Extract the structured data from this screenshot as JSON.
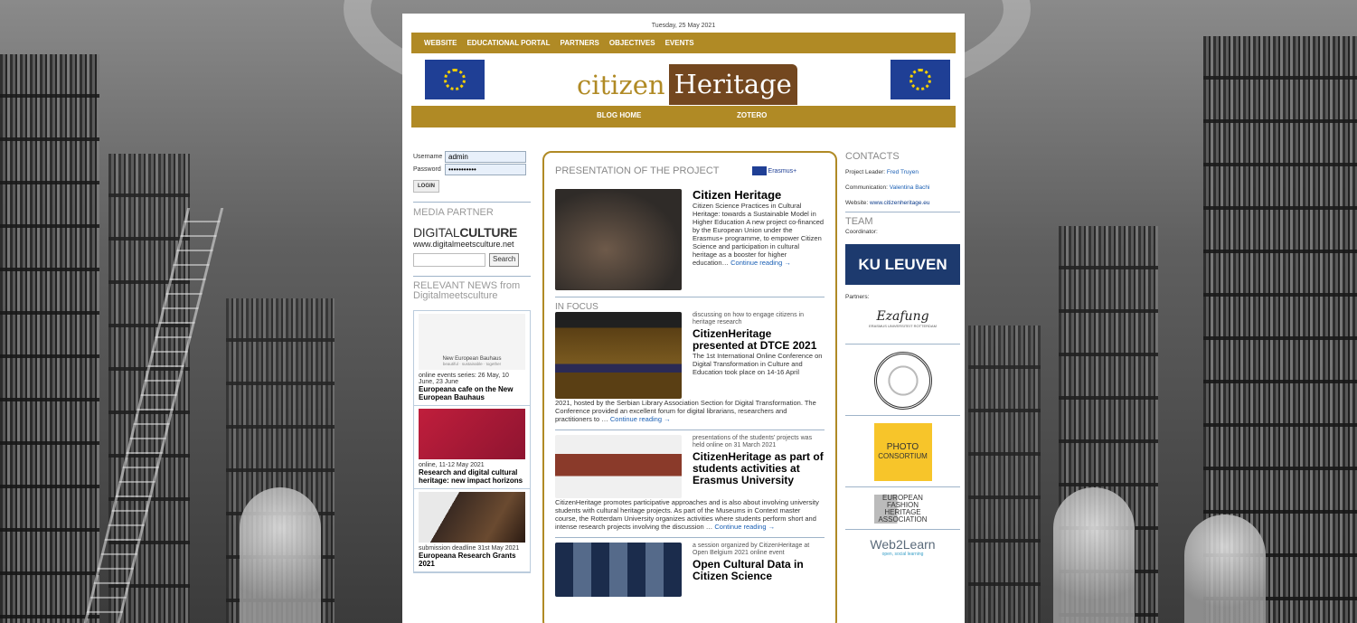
{
  "date": "Tuesday, 25 May 2021",
  "topnav": [
    "WEBSITE",
    "EDUCATIONAL PORTAL",
    "PARTNERS",
    "OBJECTIVES",
    "EVENTS"
  ],
  "logo": {
    "part1": "citizen",
    "part2": "Heritage"
  },
  "subnav": {
    "blog": "BLOG HOME",
    "zotero": "ZOTERO"
  },
  "login": {
    "username_label": "Username",
    "username_value": "admin",
    "password_label": "Password",
    "password_value": "•••••••••••",
    "button": "LOGIN"
  },
  "media_partner": {
    "title": "MEDIA PARTNER",
    "logo_a": "DIGITAL",
    "logo_b": "CULTURE",
    "url": "www.digitalmeetsculture.net",
    "search_button": "Search"
  },
  "relevant": {
    "title": "RELEVANT NEWS from Digitalmeetsculture",
    "items": [
      {
        "img_text": "New European Bauhaus",
        "img_sub": "beautiful · sustainable · together",
        "meta": "online events series: 26 May, 10 June, 23 June",
        "title": "Europeana cafe on the New European Bauhaus"
      },
      {
        "img_text": "",
        "img_sub": "",
        "meta": "online, 11-12 May 2021",
        "title": "Research and digital cultural heritage: new impact horizons"
      },
      {
        "img_text": "",
        "img_sub": "",
        "meta": "submission deadline 31st May 2021",
        "title": "Europeana Research Grants 2021"
      }
    ]
  },
  "center": {
    "presentation_title": "PRESENTATION OF THE PROJECT",
    "erasmus": "Erasmus+",
    "article": {
      "title": "Citizen Heritage",
      "body": "Citizen Science Practices in Cultural Heritage: towards a Sustainable Model in Higher Education A new project co-financed by the European Union under the Erasmus+ programme, to empower Citizen Science and participation in cultural heritage as a booster for higher education…",
      "more": "Continue reading →"
    },
    "in_focus": "IN FOCUS",
    "features": [
      {
        "meta": "discussing on how to engage citizens in heritage research",
        "title": "CitizenHeritage presented at DTCE 2021",
        "body_a": "The 1st International Online Conference on Digital Transformation in Culture and Education took place on 14-16 April",
        "body_b": "2021, hosted by the Serbian Library Association Section for Digital Transformation. The Conference provided an excellent forum for digital librarians, researchers and practitioners to …",
        "more": "Continue reading →"
      },
      {
        "meta": "presentations of the students' projects was held online on 31 March 2021",
        "title": "CitizenHeritage as part of students activities at Erasmus University",
        "body_a": "",
        "body_b": "CitizenHeritage promotes participative approaches and is also about involving university students with cultural heritage projects. As part of the Museums in Context master course, the Rotterdam University organizes activities where students perform short and intense research projects involving the discussion …",
        "more": "Continue reading →"
      },
      {
        "meta": "a session organized by CitizenHeritage at Open Belgium 2021 online event",
        "title": "Open Cultural Data in Citizen Science",
        "body_a": "",
        "body_b": "",
        "more": ""
      }
    ]
  },
  "contacts": {
    "title": "CONTACTS",
    "leader_label": "Project Leader:",
    "leader": "Fred Truyen",
    "comm_label": "Communication:",
    "comm": "Valentina Bachi",
    "web_label": "Website:",
    "web": "www.citizenheritage.eu",
    "team": "TEAM",
    "coordinator": "Coordinator:",
    "kul": "KU LEUVEN",
    "partners": "Partners:",
    "erasmus_univ": "Ezafung",
    "erasmus_univ_sub": "ERASMUS UNIVERSITEIT ROTTERDAM",
    "photo": "PHOTO",
    "photo2": "CONSORTIUM",
    "efha": "EUROPEAN FASHION HERITAGE ASSOCIATION",
    "web2learn": "Web2Learn",
    "web2learn_sub": "open, social learning"
  },
  "colors": {
    "gold": "#b08a25",
    "brown": "#73471f",
    "eu_blue": "#1f3f95",
    "link": "#1a5fb4"
  }
}
